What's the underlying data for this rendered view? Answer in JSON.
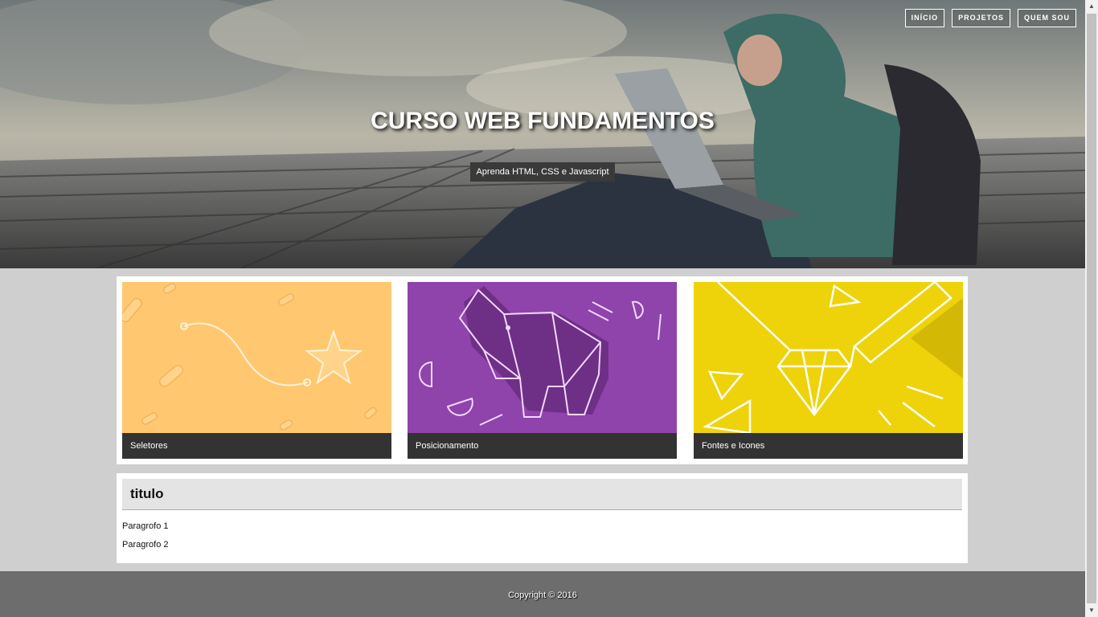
{
  "nav": {
    "items": [
      "INÍCIO",
      "PROJETOS",
      "QUEM SOU"
    ]
  },
  "hero": {
    "title": "CURSO WEB FUNDAMENTOS",
    "subtitle": "Aprenda HTML, CSS e Javascript"
  },
  "cards": [
    {
      "label": "Seletores",
      "color": "#ffc870"
    },
    {
      "label": "Posicionamento",
      "color": "#8e44aa"
    },
    {
      "label": "Fontes e Icones",
      "color": "#eed30a"
    }
  ],
  "content": {
    "title": "titulo",
    "paragraphs": [
      "Paragrofo 1",
      "Paragrofo 2"
    ]
  },
  "footer": {
    "copyright": "Copyright © 2016"
  }
}
